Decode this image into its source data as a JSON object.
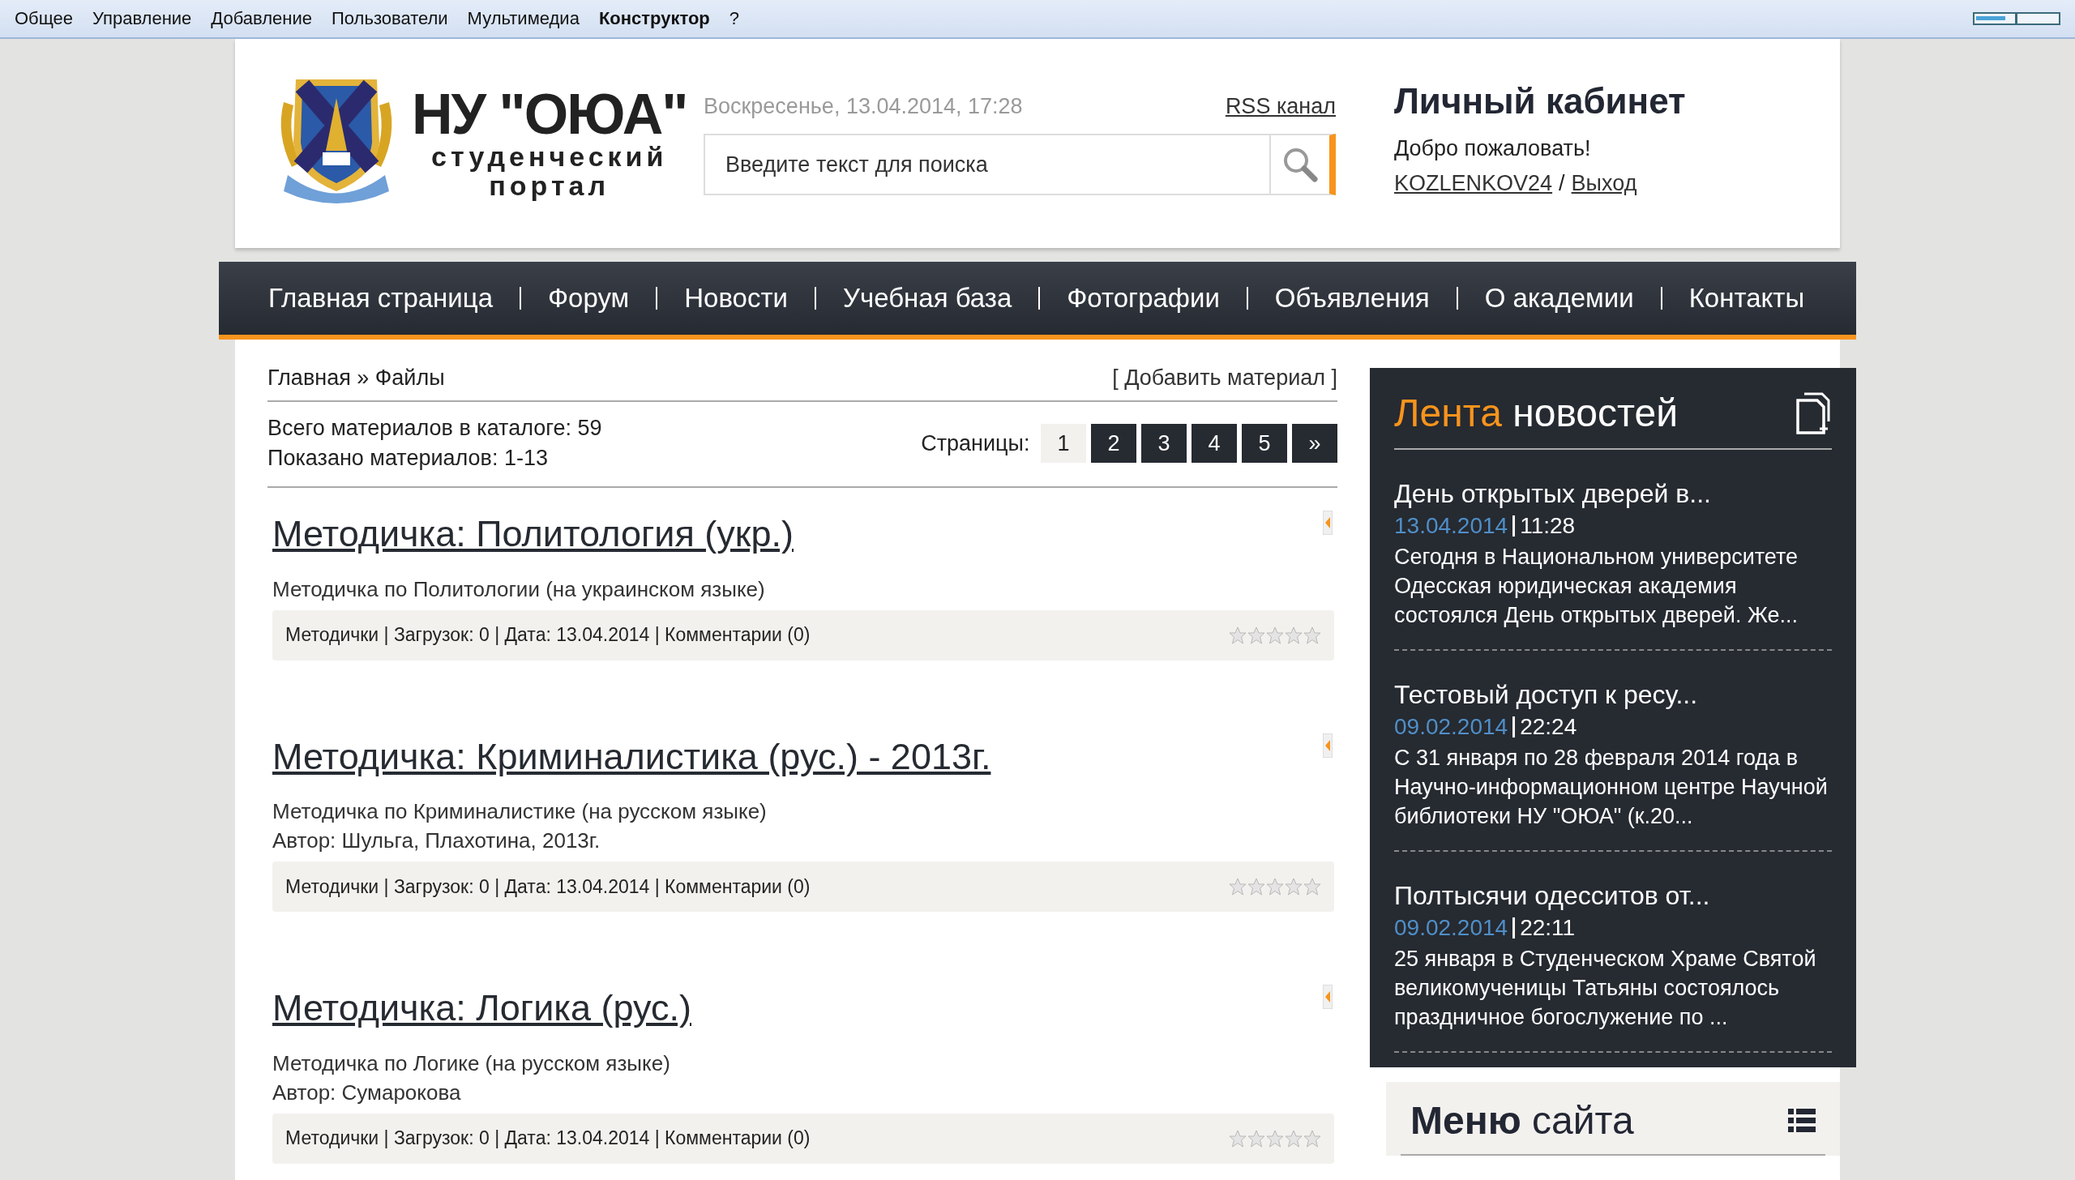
{
  "admin_bar": {
    "items": [
      {
        "label": "Общее",
        "selected": false
      },
      {
        "label": "Управление",
        "selected": false
      },
      {
        "label": "Добавление",
        "selected": false
      },
      {
        "label": "Пользователи",
        "selected": false
      },
      {
        "label": "Мультимедиа",
        "selected": false
      },
      {
        "label": "Конструктор",
        "selected": true
      },
      {
        "label": "?",
        "selected": false
      }
    ]
  },
  "header": {
    "logo": {
      "title": "НУ \"ОЮА\"",
      "line_1": "студенческий",
      "line_2": "портал"
    },
    "date": "Воскресенье, 13.04.2014, 17:28",
    "rss": "RSS канал",
    "search": {
      "placeholder": "Введите текст для поиска"
    },
    "account": {
      "title": "Личный кабинет",
      "welcome": "Добро пожаловать!",
      "user": "KOZLENKOV24",
      "separator": "/",
      "logout": "Выход"
    }
  },
  "nav": {
    "items": [
      "Главная страница",
      "Форум",
      "Новости",
      "Учебная база",
      "Фотографии",
      "Объявления",
      "О академии",
      "Контакты"
    ]
  },
  "content": {
    "breadcrumb": "Главная » Файлы",
    "add_link": "[ Добавить материал ]",
    "total": "Всего материалов в каталоге: 59",
    "shown": "Показано материалов: 1-13",
    "pages_label": "Страницы:",
    "pages": [
      {
        "label": "1",
        "selected": true
      },
      {
        "label": "2",
        "selected": false
      },
      {
        "label": "3",
        "selected": false
      },
      {
        "label": "4",
        "selected": false
      },
      {
        "label": "5",
        "selected": false
      },
      {
        "label": "»",
        "selected": false
      }
    ],
    "items": [
      {
        "title": "Методичка: Политология (укр.)",
        "lines": [
          "Методичка по Политологии (на украинском языке)"
        ],
        "meta": "Методички | Загрузок: 0 | Дата: 13.04.2014 | Комментарии (0)",
        "stars": 0
      },
      {
        "title": "Методичка: Криминалистика (рус.) - 2013г.",
        "lines": [
          "Методичка по Криминалистике (на русском языке)",
          "Автор: Шульга, Плахотина, 2013г."
        ],
        "meta": "Методички | Загрузок: 0 | Дата: 13.04.2014 | Комментарии (0)",
        "stars": 0
      },
      {
        "title": "Методичка: Логика (рус.)",
        "lines": [
          "Методичка по Логике (на русском языке)",
          "Автор: Сумарокова"
        ],
        "meta": "Методички | Загрузок: 0 | Дата: 13.04.2014 | Комментарии (0)",
        "stars": 0
      }
    ]
  },
  "news": {
    "title_accent": "Лента",
    "title": "новостей",
    "items": [
      {
        "title": "День открытых дверей в...",
        "date": "13.04.2014",
        "time": "11:28",
        "text": "Сегодня в Национальном университете Одесская юридическая академия состоялся День открытых дверей. Же..."
      },
      {
        "title": "Тестовый доступ к ресу...",
        "date": "09.02.2014",
        "time": "22:24",
        "text": "С 31 января по 28 февраля 2014 года в Научно-информационном центре Научной библиотеки НУ \"ОЮА\" (к.20..."
      },
      {
        "title": "Полтысячи одесситов от...",
        "date": "09.02.2014",
        "time": "22:11",
        "text": "25 января в Студенческом Храме Святой великомученицы Татьяны состоялось праздничное богослужение по ..."
      }
    ]
  },
  "site_menu": {
    "title": "**Меню** сайта"
  }
}
